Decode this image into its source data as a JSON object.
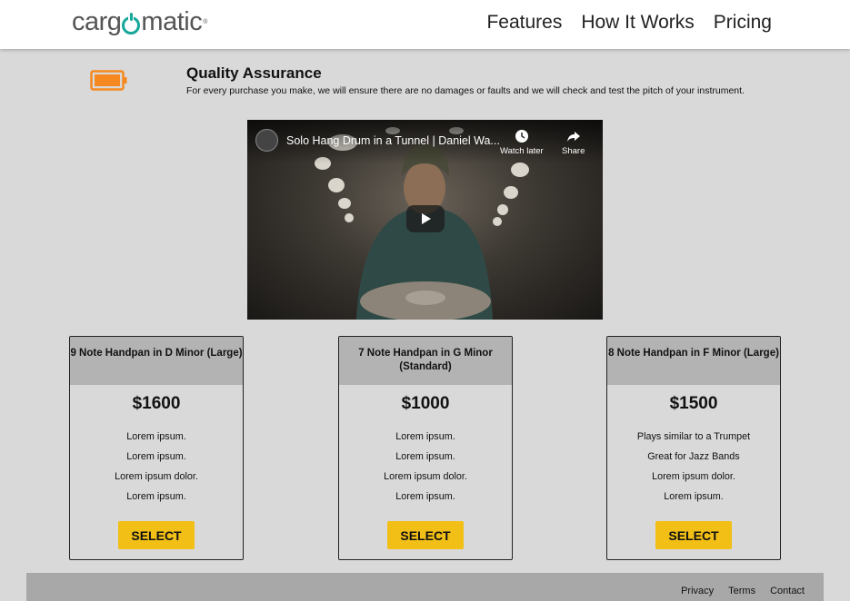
{
  "header": {
    "logo": {
      "text_before": "carg",
      "text_after": "matic",
      "trademark": "®",
      "accent": "#17a89a"
    },
    "nav": [
      "Features",
      "How It Works",
      "Pricing"
    ]
  },
  "feature": {
    "icon": "battery-icon",
    "icon_color": "#f5891f",
    "title": "Quality Assurance",
    "description": "For every purchase you make, we will ensure there are no damages or faults and we will check and test the pitch of your instrument."
  },
  "video": {
    "title": "Solo Hang Drum in a Tunnel | Daniel Wa...",
    "watch_later": "Watch later",
    "share": "Share"
  },
  "plans": [
    {
      "name": "9 Note Handpan in D Minor (Large)",
      "price": "$1600",
      "features": [
        "Lorem ipsum.",
        "Lorem ipsum.",
        "Lorem ipsum dolor.",
        "Lorem ipsum."
      ],
      "button": "SELECT"
    },
    {
      "name": "7 Note Handpan in G Minor (Standard)",
      "price": "$1000",
      "features": [
        "Lorem ipsum.",
        "Lorem ipsum.",
        "Lorem ipsum dolor.",
        "Lorem ipsum."
      ],
      "button": "SELECT"
    },
    {
      "name": "8 Note Handpan in F Minor (Large)",
      "price": "$1500",
      "features": [
        "Plays similar to a Trumpet",
        "Great for Jazz Bands",
        "Lorem ipsum dolor.",
        "Lorem ipsum."
      ],
      "button": "SELECT"
    }
  ],
  "footer": {
    "links": [
      "Privacy",
      "Terms",
      "Contact"
    ]
  },
  "colors": {
    "button": "#f2bf16",
    "card_header": "#b3b3b3",
    "background": "#d9d9d9"
  }
}
